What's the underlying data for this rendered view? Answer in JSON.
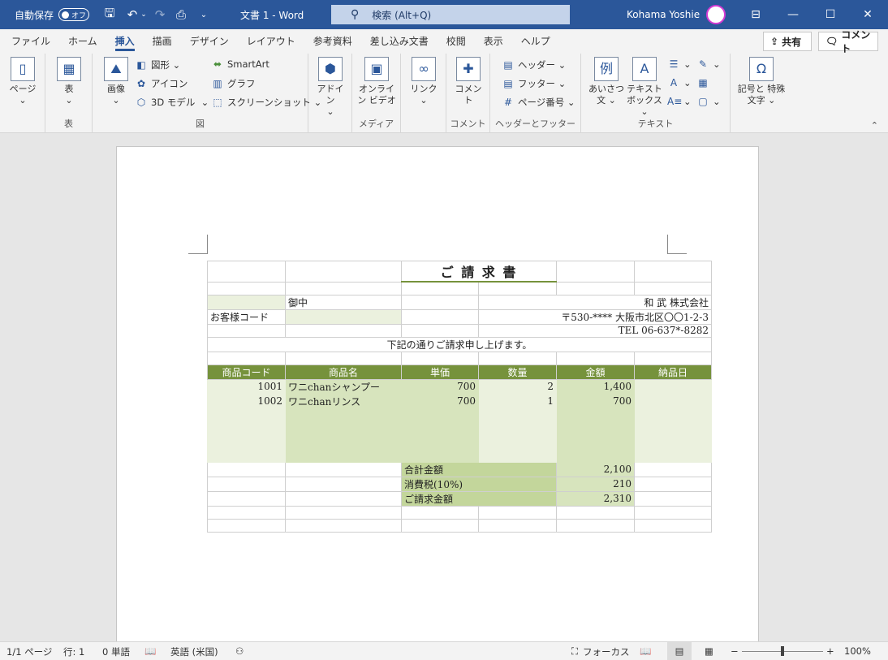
{
  "titlebar": {
    "autosave_label": "自動保存",
    "autosave_state": "オフ",
    "doc_title": "文書 1  -  Word",
    "search_placeholder": "検索 (Alt+Q)",
    "user_name": "Kohama Yoshie",
    "accent_color": "#2b579a"
  },
  "tabs": [
    "ファイル",
    "ホーム",
    "挿入",
    "描画",
    "デザイン",
    "レイアウト",
    "参考資料",
    "差し込み文書",
    "校閲",
    "表示",
    "ヘルプ"
  ],
  "active_tab": "挿入",
  "share_button": "共有",
  "comment_button": "コメント",
  "ribbon": {
    "page": "ページ",
    "table": "表",
    "table_group": "表",
    "image": "画像",
    "shapes": "図形",
    "icons": "アイコン",
    "model3d": "3D モデル",
    "smartart": "SmartArt",
    "graph": "グラフ",
    "screenshot": "スクリーンショット",
    "figure_group": "図",
    "addin": "アドイン",
    "online_video": "オンライン ビデオ",
    "media_group": "メディア",
    "link": "リンク",
    "comment": "コメント",
    "comment_group": "コメント",
    "header": "ヘッダー",
    "footer": "フッター",
    "page_number": "ページ番号",
    "hf_group": "ヘッダーとフッター",
    "greeting": "あいさつ文",
    "textbox": "テキスト ボックス",
    "text_group": "テキスト",
    "symbol": "記号と 特殊文字"
  },
  "invoice": {
    "title": "ご 請 求 書",
    "honorific": "御中",
    "company": "和 武 株式会社",
    "customer_code_label": "お客様コード",
    "address": "〒530-****  大阪市北区〇〇1-2-3",
    "tel": "TEL  06-637*-8282",
    "message": "下記の通りご請求申し上げます。",
    "headers": [
      "商品コード",
      "商品名",
      "単価",
      "数量",
      "金額",
      "納品日"
    ],
    "rows": [
      [
        "1001",
        "ワニchanシャンプー",
        "700",
        "2",
        "1,400",
        ""
      ],
      [
        "1002",
        "ワニchanリンス",
        "700",
        "1",
        "700",
        ""
      ]
    ],
    "subtotal_label": "合計金額",
    "subtotal": "2,100",
    "tax_label": "消費税(10%)",
    "tax": "210",
    "total_label": "ご請求金額",
    "total": "2,310",
    "header_color": "#76923c",
    "light_green": "#ebf1de",
    "mid_green": "#d7e4bd",
    "strong_green": "#c3d69b"
  },
  "status": {
    "page": "1/1 ページ",
    "line": "行: 1",
    "words": "0 単語",
    "language": "英語 (米国)",
    "focus": "フォーカス",
    "zoom": "100%"
  }
}
